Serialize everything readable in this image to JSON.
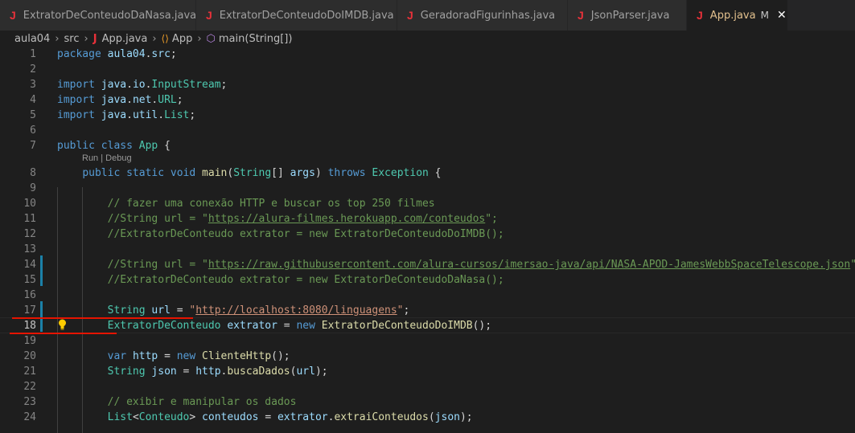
{
  "tabs": [
    {
      "label": "ExtratorDeConteudoDaNasa.java",
      "icon": "java-file-icon"
    },
    {
      "label": "ExtratorDeConteudoDoIMDB.java",
      "icon": "java-file-icon"
    },
    {
      "label": "GeradoradFigurinhas.java",
      "icon": "java-file-icon"
    },
    {
      "label": "JsonParser.java",
      "icon": "java-file-icon"
    },
    {
      "label": "App.java",
      "icon": "java-file-icon",
      "active": true,
      "modified": "M",
      "close": "✕"
    }
  ],
  "breadcrumb": {
    "items": [
      "aula04",
      "src",
      "App.java",
      "App",
      "main(String[])"
    ],
    "separator": "›"
  },
  "icons": {
    "java_glyph": "J",
    "class_glyph": "⟨⟩",
    "method_glyph": "⬡"
  },
  "codelens": "Run | Debug",
  "lines": [
    {
      "n": "1",
      "parts": [
        [
          "kw",
          "package"
        ],
        [
          "pl",
          " "
        ],
        [
          "var",
          "aula04"
        ],
        [
          "pl",
          "."
        ],
        [
          "var",
          "src"
        ],
        [
          "pl",
          ";"
        ]
      ]
    },
    {
      "n": "2",
      "parts": []
    },
    {
      "n": "3",
      "parts": [
        [
          "kw",
          "import"
        ],
        [
          "pl",
          " "
        ],
        [
          "var",
          "java"
        ],
        [
          "pl",
          "."
        ],
        [
          "var",
          "io"
        ],
        [
          "pl",
          "."
        ],
        [
          "ty",
          "InputStream"
        ],
        [
          "pl",
          ";"
        ]
      ]
    },
    {
      "n": "4",
      "parts": [
        [
          "kw",
          "import"
        ],
        [
          "pl",
          " "
        ],
        [
          "var",
          "java"
        ],
        [
          "pl",
          "."
        ],
        [
          "var",
          "net"
        ],
        [
          "pl",
          "."
        ],
        [
          "ty",
          "URL"
        ],
        [
          "pl",
          ";"
        ]
      ]
    },
    {
      "n": "5",
      "parts": [
        [
          "kw",
          "import"
        ],
        [
          "pl",
          " "
        ],
        [
          "var",
          "java"
        ],
        [
          "pl",
          "."
        ],
        [
          "var",
          "util"
        ],
        [
          "pl",
          "."
        ],
        [
          "ty",
          "List"
        ],
        [
          "pl",
          ";"
        ]
      ]
    },
    {
      "n": "6",
      "parts": []
    },
    {
      "n": "7",
      "parts": [
        [
          "kw",
          "public"
        ],
        [
          "pl",
          " "
        ],
        [
          "kw",
          "class"
        ],
        [
          "pl",
          " "
        ],
        [
          "ty",
          "App"
        ],
        [
          "pl",
          " {"
        ]
      ]
    },
    {
      "n": "8",
      "parts": [
        [
          "pl",
          "    "
        ],
        [
          "kw",
          "public"
        ],
        [
          "pl",
          " "
        ],
        [
          "kw",
          "static"
        ],
        [
          "pl",
          " "
        ],
        [
          "kw",
          "void"
        ],
        [
          "pl",
          " "
        ],
        [
          "fn",
          "main"
        ],
        [
          "pl",
          "("
        ],
        [
          "ty",
          "String"
        ],
        [
          "pl",
          "[] "
        ],
        [
          "var",
          "args"
        ],
        [
          "pl",
          ") "
        ],
        [
          "kw",
          "throws"
        ],
        [
          "pl",
          " "
        ],
        [
          "ty",
          "Exception"
        ],
        [
          "pl",
          " {"
        ]
      ]
    },
    {
      "n": "9",
      "parts": []
    },
    {
      "n": "10",
      "parts": [
        [
          "pl",
          "        "
        ],
        [
          "com",
          "// fazer uma conexão HTTP e buscar os top 250 filmes"
        ]
      ]
    },
    {
      "n": "11",
      "parts": [
        [
          "pl",
          "        "
        ],
        [
          "com",
          "//String url = \""
        ],
        [
          "com link",
          "https://alura-filmes.herokuapp.com/conteudos"
        ],
        [
          "com",
          "\";"
        ]
      ]
    },
    {
      "n": "12",
      "parts": [
        [
          "pl",
          "        "
        ],
        [
          "com",
          "//ExtratorDeConteudo extrator = new ExtratorDeConteudoDoIMDB();"
        ]
      ]
    },
    {
      "n": "13",
      "parts": []
    },
    {
      "n": "14",
      "parts": [
        [
          "pl",
          "        "
        ],
        [
          "com",
          "//String url = \""
        ],
        [
          "com link",
          "https://raw.githubusercontent.com/alura-cursos/imersao-java/api/NASA-APOD-JamesWebbSpaceTelescope.json"
        ],
        [
          "com",
          "\";"
        ]
      ]
    },
    {
      "n": "15",
      "parts": [
        [
          "pl",
          "        "
        ],
        [
          "com",
          "//ExtratorDeConteudo extrator = new ExtratorDeConteudoDaNasa();"
        ]
      ]
    },
    {
      "n": "16",
      "parts": []
    },
    {
      "n": "17",
      "parts": [
        [
          "pl",
          "        "
        ],
        [
          "ty",
          "String"
        ],
        [
          "pl",
          " "
        ],
        [
          "var",
          "url"
        ],
        [
          "pl",
          " = "
        ],
        [
          "str",
          "\""
        ],
        [
          "str link",
          "http://localhost:8080/linguagens"
        ],
        [
          "str",
          "\""
        ],
        [
          "pl",
          ";"
        ]
      ]
    },
    {
      "n": "18",
      "active": true,
      "parts": [
        [
          "pl",
          "        "
        ],
        [
          "ty",
          "ExtratorDeConteudo"
        ],
        [
          "pl",
          " "
        ],
        [
          "var",
          "extrator"
        ],
        [
          "pl",
          " = "
        ],
        [
          "kw",
          "new"
        ],
        [
          "pl",
          " "
        ],
        [
          "fn",
          "ExtratorDeConteudoDoIMDB"
        ],
        [
          "pl",
          "();"
        ]
      ]
    },
    {
      "n": "19",
      "parts": []
    },
    {
      "n": "20",
      "parts": [
        [
          "pl",
          "        "
        ],
        [
          "kw",
          "var"
        ],
        [
          "pl",
          " "
        ],
        [
          "var",
          "http"
        ],
        [
          "pl",
          " = "
        ],
        [
          "kw",
          "new"
        ],
        [
          "pl",
          " "
        ],
        [
          "fn",
          "ClienteHttp"
        ],
        [
          "pl",
          "();"
        ]
      ]
    },
    {
      "n": "21",
      "parts": [
        [
          "pl",
          "        "
        ],
        [
          "ty",
          "String"
        ],
        [
          "pl",
          " "
        ],
        [
          "var",
          "json"
        ],
        [
          "pl",
          " = "
        ],
        [
          "var",
          "http"
        ],
        [
          "pl",
          "."
        ],
        [
          "fn",
          "buscaDados"
        ],
        [
          "pl",
          "("
        ],
        [
          "var",
          "url"
        ],
        [
          "pl",
          ");"
        ]
      ]
    },
    {
      "n": "22",
      "parts": []
    },
    {
      "n": "23",
      "parts": [
        [
          "pl",
          "        "
        ],
        [
          "com",
          "// exibir e manipular os dados"
        ]
      ]
    },
    {
      "n": "24",
      "parts": [
        [
          "pl",
          "        "
        ],
        [
          "ty",
          "List"
        ],
        [
          "pl",
          "<"
        ],
        [
          "ty",
          "Conteudo"
        ],
        [
          "pl",
          "> "
        ],
        [
          "var",
          "conteudos"
        ],
        [
          "pl",
          " = "
        ],
        [
          "var",
          "extrator"
        ],
        [
          "pl",
          "."
        ],
        [
          "fn",
          "extraiConteudos"
        ],
        [
          "pl",
          "("
        ],
        [
          "var",
          "json"
        ],
        [
          "pl",
          ");"
        ]
      ]
    }
  ],
  "colors": {
    "accent_marker": "#e51400",
    "git_modified": "#1b81a8",
    "bulb": "#ffcc00"
  }
}
